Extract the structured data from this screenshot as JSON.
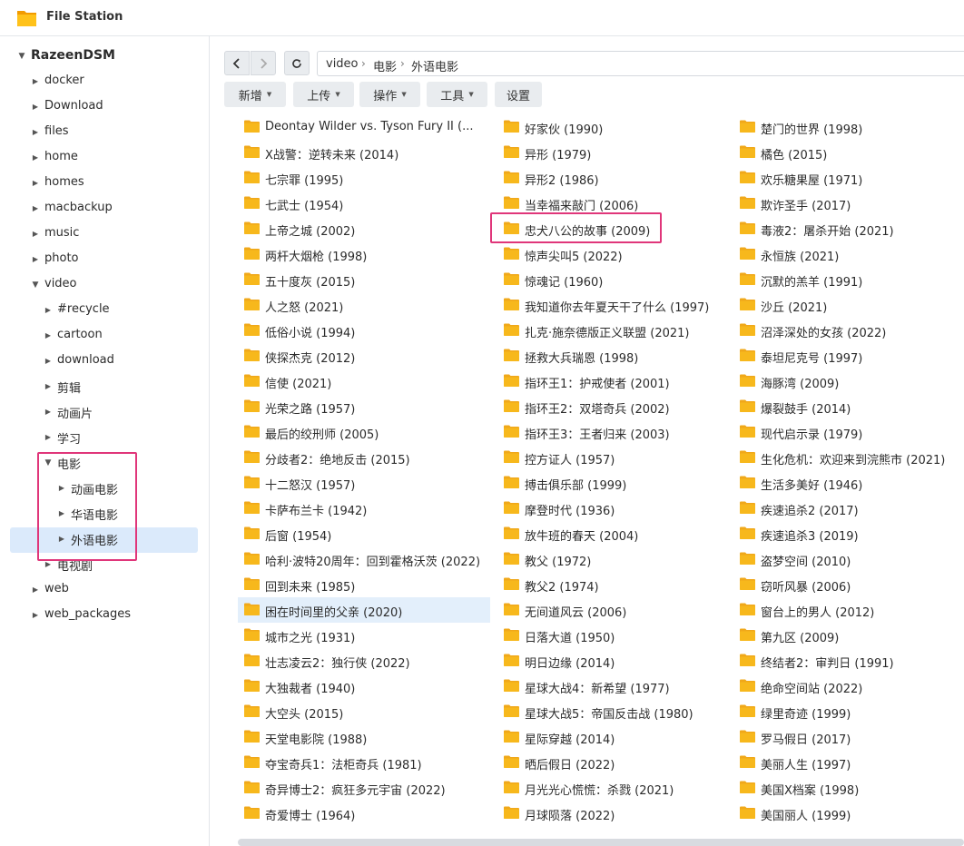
{
  "window": {
    "title": "File Station",
    "icon": "folder-app-icon"
  },
  "sidebar": {
    "root": "RazeenDSM",
    "items": [
      {
        "label": "docker"
      },
      {
        "label": "Download"
      },
      {
        "label": "files"
      },
      {
        "label": "home"
      },
      {
        "label": "homes"
      },
      {
        "label": "macbackup"
      },
      {
        "label": "music"
      },
      {
        "label": "photo"
      },
      {
        "label": "video"
      },
      {
        "label": "#recycle"
      },
      {
        "label": "cartoon"
      },
      {
        "label": "download"
      },
      {
        "label": "剪辑"
      },
      {
        "label": "动画片"
      },
      {
        "label": "学习"
      },
      {
        "label": "电影"
      },
      {
        "label": "动画电影"
      },
      {
        "label": "华语电影"
      },
      {
        "label": "外语电影"
      },
      {
        "label": "电视剧"
      },
      {
        "label": "web"
      },
      {
        "label": "web_packages"
      }
    ]
  },
  "path": {
    "crumbs": [
      "video",
      "电影",
      "外语电影"
    ],
    "separator": "›"
  },
  "toolbar": {
    "new": "新增",
    "upload": "上传",
    "action": "操作",
    "tools": "工具",
    "settings": "设置"
  },
  "files": {
    "col1": [
      "Deontay Wilder vs. Tyson Fury II (...",
      "X战警：逆转未来 (2014)",
      "七宗罪 (1995)",
      "七武士 (1954)",
      "上帝之城 (2002)",
      "两杆大烟枪 (1998)",
      "五十度灰 (2015)",
      "人之怒 (2021)",
      "低俗小说 (1994)",
      "侠探杰克 (2012)",
      "信使 (2021)",
      "光荣之路 (1957)",
      "最后的绞刑师 (2005)",
      "分歧者2：绝地反击 (2015)",
      "十二怒汉 (1957)",
      "卡萨布兰卡 (1942)",
      "后窗 (1954)",
      "哈利·波特20周年：回到霍格沃茨 (2022)",
      "回到未来 (1985)",
      "困在时间里的父亲 (2020)",
      "城市之光 (1931)",
      "壮志凌云2：独行侠 (2022)",
      "大独裁者 (1940)",
      "大空头 (2015)",
      "天堂电影院 (1988)",
      "夺宝奇兵1：法柜奇兵 (1981)",
      "奇异博士2：疯狂多元宇宙 (2022)",
      "奇爱博士 (1964)"
    ],
    "col2": [
      "好家伙 (1990)",
      "异形 (1979)",
      "异形2 (1986)",
      "当幸福来敲门 (2006)",
      "忠犬八公的故事 (2009)",
      "惊声尖叫5 (2022)",
      "惊魂记 (1960)",
      "我知道你去年夏天干了什么 (1997)",
      "扎克·施奈德版正义联盟 (2021)",
      "拯救大兵瑞恩 (1998)",
      "指环王1：护戒使者 (2001)",
      "指环王2：双塔奇兵 (2002)",
      "指环王3：王者归来 (2003)",
      "控方证人 (1957)",
      "搏击俱乐部 (1999)",
      "摩登时代 (1936)",
      "放牛班的春天 (2004)",
      "教父 (1972)",
      "教父2 (1974)",
      "无间道风云 (2006)",
      "日落大道 (1950)",
      "明日边缘 (2014)",
      "星球大战4：新希望 (1977)",
      "星球大战5：帝国反击战 (1980)",
      "星际穿越 (2014)",
      "晒后假日 (2022)",
      "月光光心慌慌：杀戮 (2021)",
      "月球陨落 (2022)"
    ],
    "col3": [
      "楚门的世界 (1998)",
      "橘色 (2015)",
      "欢乐糖果屋 (1971)",
      "欺诈圣手 (2017)",
      "毒液2：屠杀开始 (2021)",
      "永恒族 (2021)",
      "沉默的羔羊 (1991)",
      "沙丘 (2021)",
      "沼泽深处的女孩 (2022)",
      "泰坦尼克号 (1997)",
      "海豚湾 (2009)",
      "爆裂鼓手 (2014)",
      "现代启示录 (1979)",
      "生化危机：欢迎来到浣熊市 (2021)",
      "生活多美好 (1946)",
      "疾速追杀2 (2017)",
      "疾速追杀3 (2019)",
      "盗梦空间 (2010)",
      "窃听风暴 (2006)",
      "窗台上的男人 (2012)",
      "第九区 (2009)",
      "终结者2：审判日 (1991)",
      "绝命空间站 (2022)",
      "绿里奇迹 (1999)",
      "罗马假日 (2017)",
      "美丽人生 (1997)",
      "美国X档案 (1998)",
      "美国丽人 (1999)"
    ]
  },
  "colors": {
    "accent_highlight": "#e0367a",
    "folder": "#f7b81c",
    "selection": "#dbeafb"
  }
}
